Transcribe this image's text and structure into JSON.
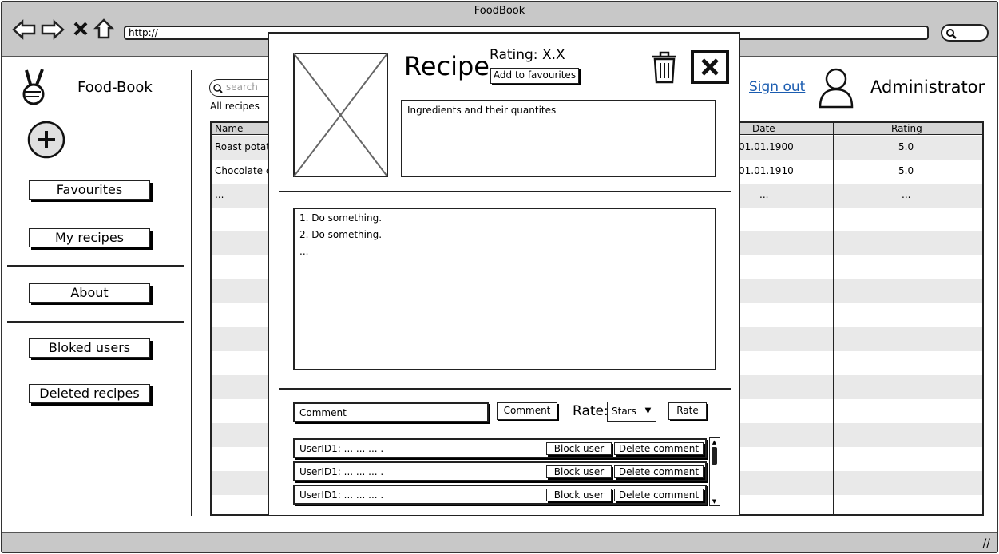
{
  "window": {
    "title": "FoodBook",
    "url": "http://"
  },
  "sidebar": {
    "app_name": "Food-Book",
    "buttons": [
      "Favourites",
      "My recipes",
      "About",
      "Bloked users",
      "Deleted recipes"
    ]
  },
  "header": {
    "search_placeholder": "search",
    "filter_label": "All recipes",
    "sign_out": "Sign out",
    "user_name": "Administrator"
  },
  "table": {
    "headers": [
      "Name",
      "Date",
      "Rating"
    ],
    "rows": [
      {
        "name": "Roast potat",
        "date": "01.01.1900",
        "rating": "5.0"
      },
      {
        "name": "Chocolate c",
        "date": "01.01.1910",
        "rating": "5.0"
      },
      {
        "name": "...",
        "date": "...",
        "rating": "..."
      }
    ]
  },
  "modal": {
    "title": "Recipe",
    "rating": "Rating: X.X",
    "add_fav": "Add to favourites",
    "ingredients": "Ingredients and their quantites",
    "steps": [
      "1. Do something.",
      "2. Do something.",
      "..."
    ],
    "comment_placeholder": "Comment",
    "comment_btn": "Comment",
    "rate_label": "Rate:",
    "rate_select": "Stars",
    "rate_btn": "Rate",
    "comments": [
      {
        "text": "UserID1: ... ... ... .",
        "block": "Block user",
        "delete": "Delete comment"
      },
      {
        "text": "UserID1: ... ... ... .",
        "block": "Block user",
        "delete": "Delete comment"
      },
      {
        "text": "UserID1: ... ... ... .",
        "block": "Block user",
        "delete": "Delete comment"
      }
    ]
  }
}
